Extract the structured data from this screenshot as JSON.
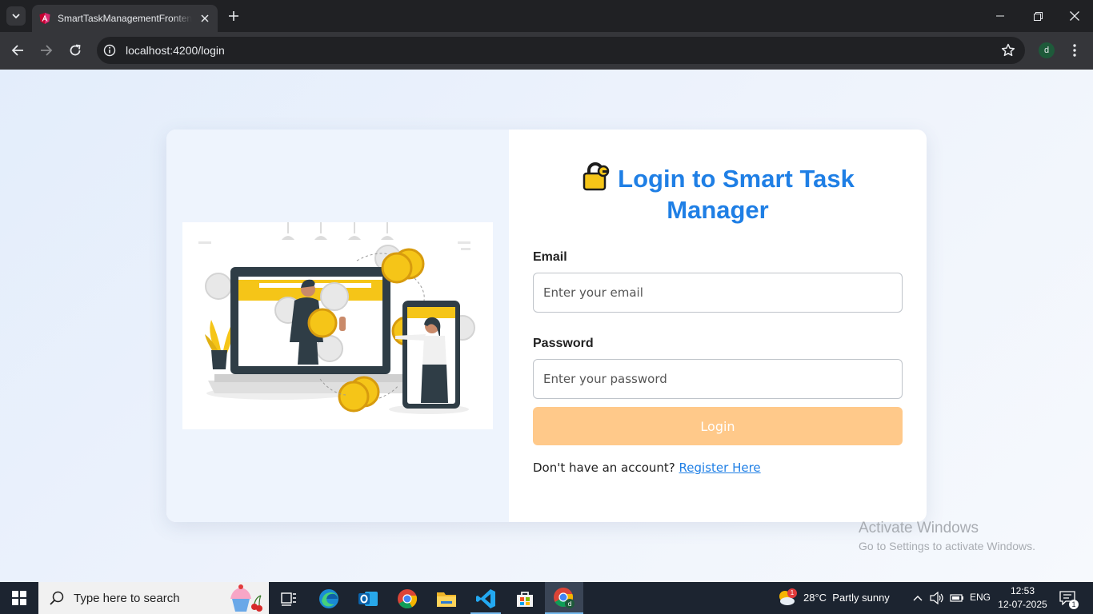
{
  "browser": {
    "tab_title": "SmartTaskManagementFrontend",
    "url": "localhost:4200/login",
    "profile_initial": "d"
  },
  "page": {
    "heading": "Login to Smart Task Manager",
    "email": {
      "label": "Email",
      "placeholder": "Enter your email"
    },
    "password": {
      "label": "Password",
      "placeholder": "Enter your password"
    },
    "login_button": "Login",
    "register_prompt": "Don't have an account? ",
    "register_link": "Register Here"
  },
  "watermark": {
    "title": "Activate Windows",
    "subtitle": "Go to Settings to activate Windows."
  },
  "taskbar": {
    "search_placeholder": "Type here to search",
    "weather": "28°C  Partly sunny",
    "weather_badge": "1",
    "language": "ENG",
    "time": "12:53",
    "date": "12-07-2025",
    "notification_count": "1"
  },
  "colors": {
    "accent": "#1f7fe5",
    "login_button": "#ffc98a",
    "card_left_bg": "#eef4fd"
  },
  "icons": [
    "tab-list-icon",
    "angular-favicon",
    "close-icon",
    "plus-icon",
    "minimize-icon",
    "restore-icon",
    "back-icon",
    "forward-icon",
    "reload-icon",
    "site-info-icon",
    "star-icon",
    "menu-dots-icon",
    "lock-icon",
    "windows-start-icon",
    "search-icon",
    "task-view-icon",
    "edge-icon",
    "outlook-icon",
    "chrome-icon",
    "file-explorer-icon",
    "vscode-icon",
    "store-icon",
    "chrome-profile-icon",
    "weather-icon",
    "chevron-up-icon",
    "speaker-icon",
    "battery-icon",
    "notification-icon"
  ]
}
